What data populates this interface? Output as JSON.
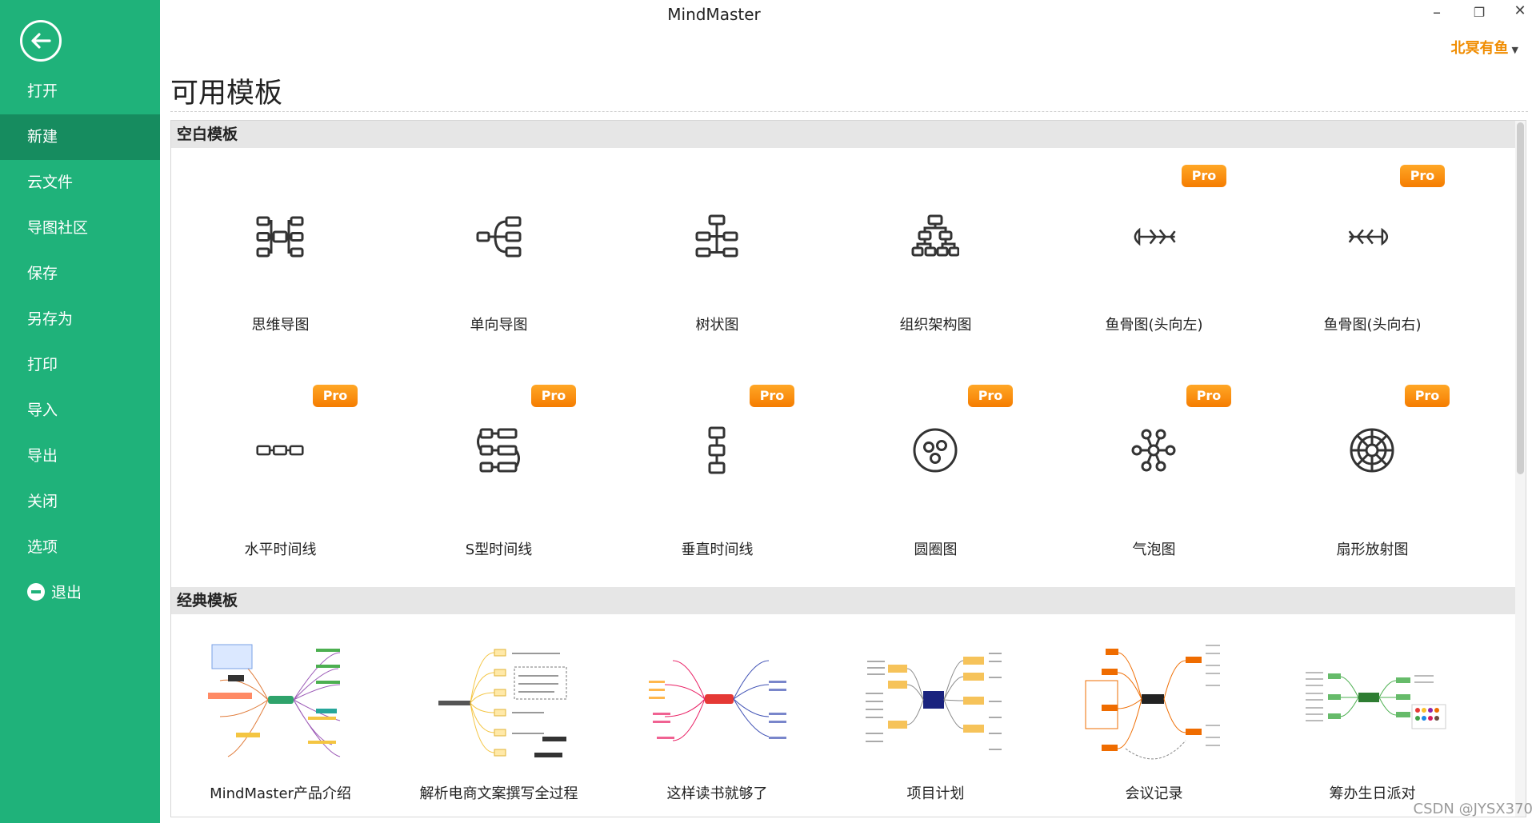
{
  "app": {
    "title": "MindMaster",
    "user": "北冥有鱼"
  },
  "sidebar": {
    "items": [
      {
        "label": "打开"
      },
      {
        "label": "新建",
        "active": true
      },
      {
        "label": "云文件"
      },
      {
        "label": "导图社区"
      },
      {
        "label": "保存"
      },
      {
        "label": "另存为"
      },
      {
        "label": "打印"
      },
      {
        "label": "导入"
      },
      {
        "label": "导出"
      },
      {
        "label": "关闭"
      },
      {
        "label": "选项"
      },
      {
        "label": "退出"
      }
    ]
  },
  "main": {
    "title": "可用模板",
    "sections": [
      {
        "title": "空白模板",
        "templates": [
          {
            "label": "思维导图",
            "icon": "mind-map-icon",
            "pro": false
          },
          {
            "label": "单向导图",
            "icon": "right-map-icon",
            "pro": false
          },
          {
            "label": "树状图",
            "icon": "tree-icon",
            "pro": false
          },
          {
            "label": "组织架构图",
            "icon": "org-chart-icon",
            "pro": false
          },
          {
            "label": "鱼骨图(头向左)",
            "icon": "fishbone-left-icon",
            "pro": true
          },
          {
            "label": "鱼骨图(头向右)",
            "icon": "fishbone-right-icon",
            "pro": true
          },
          {
            "label": "水平时间线",
            "icon": "horizontal-timeline-icon",
            "pro": true
          },
          {
            "label": "S型时间线",
            "icon": "s-timeline-icon",
            "pro": true
          },
          {
            "label": "垂直时间线",
            "icon": "vertical-timeline-icon",
            "pro": true
          },
          {
            "label": "圆圈图",
            "icon": "circle-map-icon",
            "pro": true
          },
          {
            "label": "气泡图",
            "icon": "bubble-map-icon",
            "pro": true
          },
          {
            "label": "扇形放射图",
            "icon": "sector-radial-icon",
            "pro": true
          }
        ]
      },
      {
        "title": "经典模板",
        "templates": [
          {
            "label": "MindMaster产品介绍"
          },
          {
            "label": "解析电商文案撰写全过程"
          },
          {
            "label": "这样读书就够了"
          },
          {
            "label": "项目计划"
          },
          {
            "label": "会议记录"
          },
          {
            "label": "筹办生日派对"
          }
        ]
      }
    ]
  },
  "badge": {
    "pro_label": "Pro"
  },
  "window": {
    "minimize": "–",
    "restore": "❐",
    "close": "✕"
  },
  "watermark": "CSDN @JYSX370"
}
